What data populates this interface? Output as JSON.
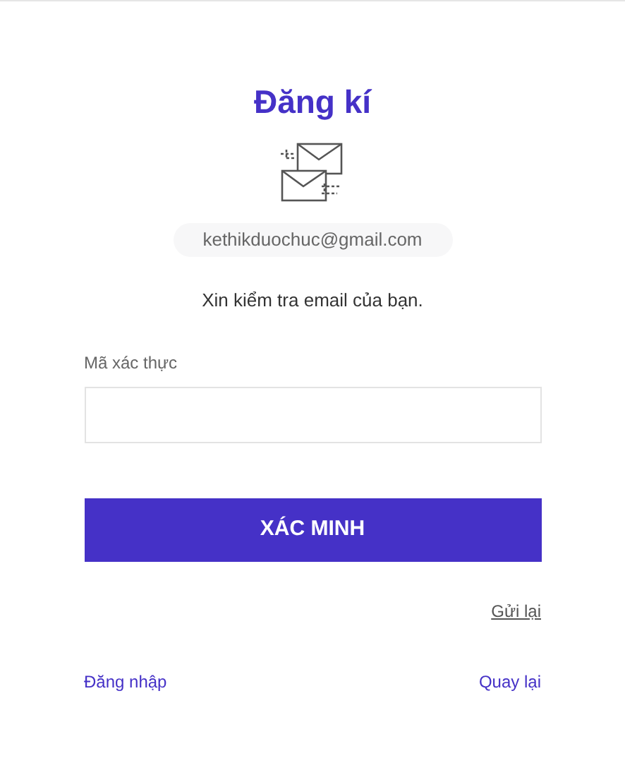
{
  "title": "Đăng kí",
  "email": "kethikduochuc@gmail.com",
  "message": "Xin kiểm tra email của bạn.",
  "code_field": {
    "label": "Mã xác thực"
  },
  "verify_button": "XÁC MINH",
  "resend_link": "Gửi lại",
  "footer_links": [
    "Đăng nhập",
    "Quay lại"
  ]
}
